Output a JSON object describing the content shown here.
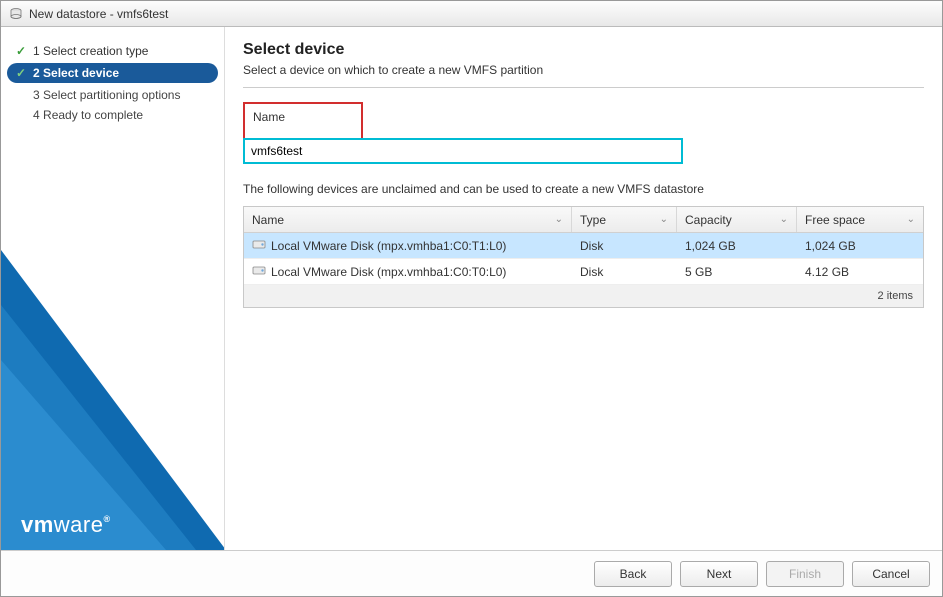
{
  "title": "New datastore - vmfs6test",
  "sidebar": {
    "steps": [
      {
        "label_num": "1",
        "label_text": "Select creation type",
        "completed": true,
        "active": false
      },
      {
        "label_num": "2",
        "label_text": "Select device",
        "completed": true,
        "active": true
      },
      {
        "label_num": "3",
        "label_text": "Select partitioning options",
        "completed": false,
        "active": false
      },
      {
        "label_num": "4",
        "label_text": "Ready to complete",
        "completed": false,
        "active": false
      }
    ],
    "brand": "vmware"
  },
  "main": {
    "heading": "Select device",
    "subheading": "Select a device on which to create a new VMFS partition",
    "name_label": "Name",
    "name_value": "vmfs6test",
    "devices_desc": "The following devices are unclaimed and can be used to create a new VMFS datastore",
    "columns": {
      "name": "Name",
      "type": "Type",
      "capacity": "Capacity",
      "free": "Free space"
    },
    "rows": [
      {
        "name": "Local VMware Disk (mpx.vmhba1:C0:T1:L0)",
        "type": "Disk",
        "capacity": "1,024 GB",
        "free": "1,024 GB",
        "selected": true
      },
      {
        "name": "Local VMware Disk (mpx.vmhba1:C0:T0:L0)",
        "type": "Disk",
        "capacity": "5 GB",
        "free": "4.12 GB",
        "selected": false
      }
    ],
    "items_label": "2 items"
  },
  "footer": {
    "back": "Back",
    "next": "Next",
    "finish": "Finish",
    "cancel": "Cancel"
  }
}
